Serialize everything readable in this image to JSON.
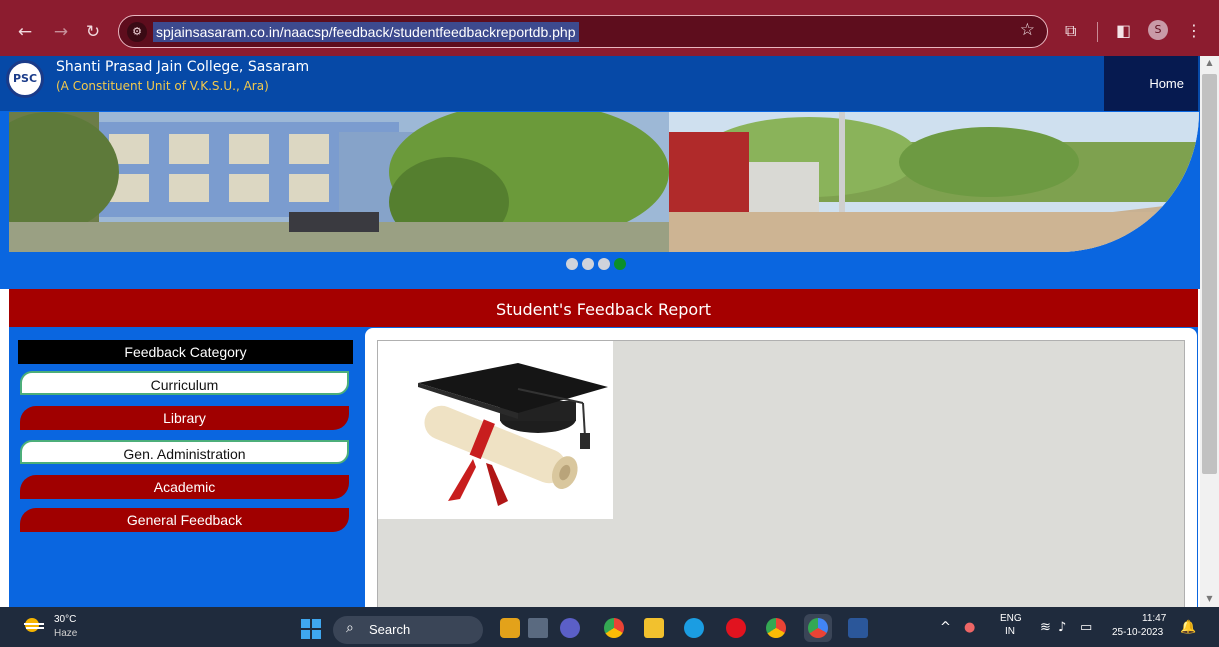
{
  "browser": {
    "url": "spjainsasaram.co.in/naacsp/feedback/studentfeedbackreportdb.php",
    "profile_initial": "S"
  },
  "site": {
    "logo_text": "PSC",
    "college_name": "Shanti Prasad Jain College, Sasaram",
    "college_subtitle": "(A Constituent Unit of V.K.S.U., Ara)",
    "home_label": "Home"
  },
  "page": {
    "title": "Student's Feedback Report"
  },
  "sidebar": {
    "header": "Feedback Category",
    "items": [
      {
        "label": "Curriculum"
      },
      {
        "label": "Library"
      },
      {
        "label": "Gen. Administration"
      },
      {
        "label": "Academic"
      },
      {
        "label": "General Feedback"
      }
    ]
  },
  "taskbar": {
    "weather_temp": "30°C",
    "weather_condition": "Haze",
    "search_label": "Search",
    "lang_top": "ENG",
    "lang_bottom": "IN",
    "time": "11:47",
    "date": "25-10-2023"
  },
  "colors": {
    "chrome": "#8c1c2f",
    "header_blue": "#0649a7",
    "panel_blue": "#0a66e0",
    "title_red": "#a50000",
    "active_dot": "#0b8f2a"
  },
  "carousel": {
    "slide_count": 4,
    "active_index": 3
  }
}
